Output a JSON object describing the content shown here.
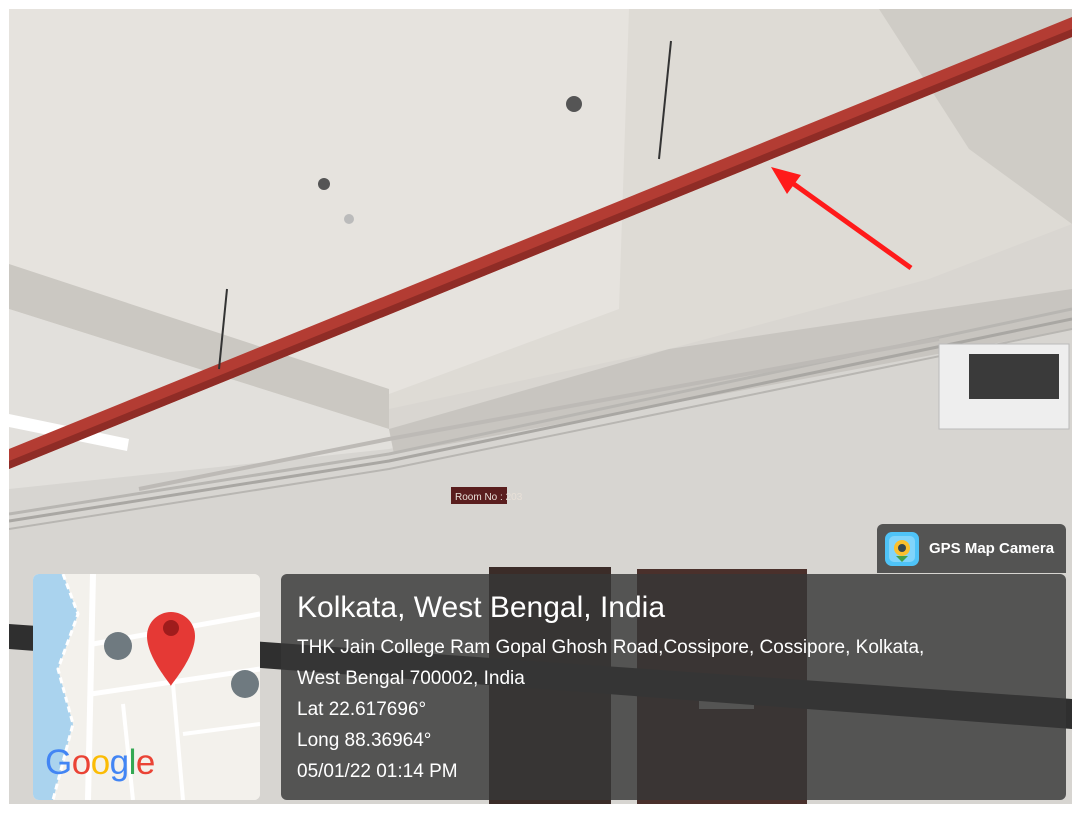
{
  "photo": {
    "description_icon": "ceiling-sprinkler-pipe-photo",
    "room_sign": "Room No : 203",
    "pipe_color": "#b33c33",
    "arrow_color": "#ff1a1a"
  },
  "map": {
    "logo_letters": [
      "G",
      "o",
      "o",
      "g",
      "l",
      "e"
    ],
    "logo_colors": [
      "#4285f4",
      "#ea4335",
      "#fbbc05",
      "#4285f4",
      "#34a853",
      "#ea4335"
    ],
    "pin_color": "#e53935",
    "icon": "map-pin-icon"
  },
  "badge": {
    "label": "GPS Map Camera",
    "icon": "gps-map-camera-app-icon"
  },
  "info": {
    "title": "Kolkata, West Bengal, India",
    "address_line1": "THK Jain College Ram Gopal Ghosh Road,Cossipore, Cossipore, Kolkata,",
    "address_line2": "West Bengal 700002, India",
    "lat": "Lat 22.617696°",
    "long": "Long 88.36964°",
    "datetime": "05/01/22 01:14 PM"
  }
}
